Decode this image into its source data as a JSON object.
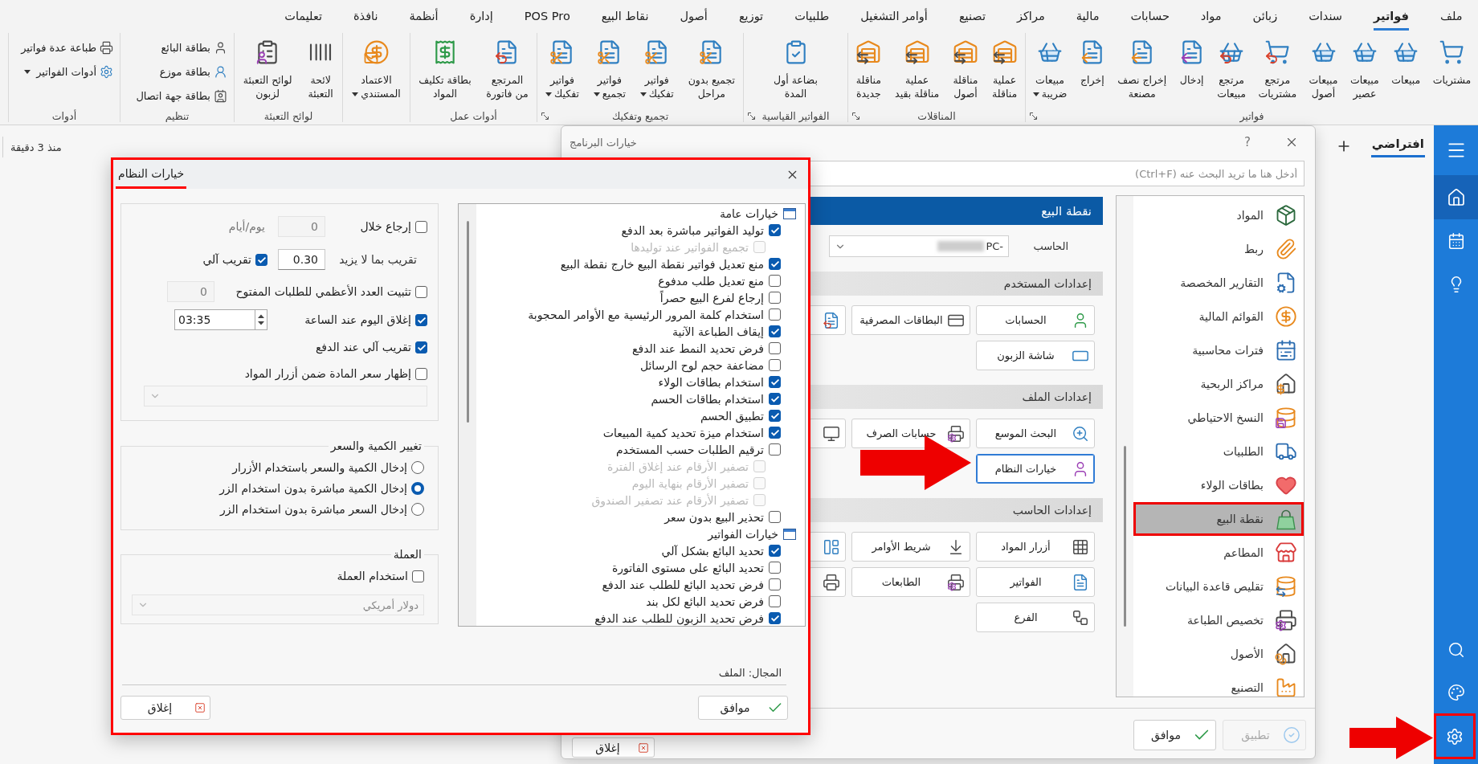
{
  "ribbon": {
    "tabs": [
      {
        "label": "ملف",
        "selected": false
      },
      {
        "label": "فواتير",
        "selected": true
      },
      {
        "label": "سندات",
        "selected": false
      },
      {
        "label": "زبائن",
        "selected": false
      },
      {
        "label": "مواد",
        "selected": false
      },
      {
        "label": "حسابات",
        "selected": false
      },
      {
        "label": "مالية",
        "selected": false
      },
      {
        "label": "مراكز",
        "selected": false
      },
      {
        "label": "تصنيع",
        "selected": false
      },
      {
        "label": "أوامر التشغيل",
        "selected": false
      },
      {
        "label": "طلبيات",
        "selected": false
      },
      {
        "label": "توزيع",
        "selected": false
      },
      {
        "label": "أصول",
        "selected": false
      },
      {
        "label": "نقاط البيع",
        "selected": false
      },
      {
        "label": "POS Pro",
        "selected": false
      },
      {
        "label": "إدارة",
        "selected": false
      },
      {
        "label": "أنظمة",
        "selected": false
      },
      {
        "label": "نافذة",
        "selected": false
      },
      {
        "label": "تعليمات",
        "selected": false
      }
    ],
    "groups": [
      {
        "label": "فواتير",
        "kind": "large",
        "launcher": true,
        "items": [
          {
            "label": "مشتريات",
            "dropdown": false
          },
          {
            "label": "مبيعات",
            "dropdown": false
          },
          {
            "label": "مبيعات\nعصير",
            "dropdown": false
          },
          {
            "label": "مبيعات\nأصول",
            "dropdown": false
          },
          {
            "label": "مرتجع\nمشتريات",
            "dropdown": false
          },
          {
            "label": "مرتجع\nمبيعات",
            "dropdown": false
          },
          {
            "label": "إدخال",
            "dropdown": false
          },
          {
            "label": "إخراج نصف\nمصنعة",
            "dropdown": false
          },
          {
            "label": "إخراج",
            "dropdown": false
          },
          {
            "label": "مبيعات\nضريبة",
            "dropdown": true
          }
        ]
      },
      {
        "label": "المناقلات",
        "kind": "large",
        "launcher": true,
        "items": [
          {
            "label": "عملية\nمناقلة",
            "dropdown": false
          },
          {
            "label": "مناقلة\nأصول",
            "dropdown": false
          },
          {
            "label": "عملية\nمناقلة بقيد",
            "dropdown": false
          },
          {
            "label": "مناقلة\nجديدة",
            "dropdown": false
          }
        ]
      },
      {
        "label": "الفواتير القياسية",
        "kind": "large",
        "launcher": true,
        "items": [
          {
            "label": "بضاعة أول\nالمدة",
            "dropdown": false
          }
        ]
      },
      {
        "label": "تجميع وتفكيك",
        "kind": "large",
        "launcher": true,
        "items": [
          {
            "label": "تجميع بدون\nمراحل",
            "dropdown": false
          },
          {
            "label": "فواتير\nتفكيك",
            "dropdown": true
          },
          {
            "label": "فواتير\nتجميع",
            "dropdown": true
          },
          {
            "label": "فواتير\nتفكيك",
            "dropdown": true
          }
        ]
      },
      {
        "label": "أدوات عمل",
        "kind": "large",
        "launcher": false,
        "items": [
          {
            "label": "المرتجع\nمن فاتورة",
            "dropdown": false
          },
          {
            "label": "بطاقة تكليف\nالمواد",
            "dropdown": false
          }
        ]
      },
      {
        "kind": "large",
        "launcher": false,
        "items": [
          {
            "label": "الاعتماد\nالمستندي",
            "dropdown": true
          }
        ]
      },
      {
        "label": "لوائح التعبئة",
        "kind": "large",
        "launcher": false,
        "items": [
          {
            "label": "لائحة\nالتعبئة",
            "dropdown": false
          },
          {
            "label": "لوائح التعبئة\nلزبون",
            "dropdown": false
          }
        ]
      },
      {
        "label": "تنظيم",
        "kind": "small",
        "launcher": false,
        "items": [
          {
            "label": "بطاقة البائع",
            "dropdown": false
          },
          {
            "label": "بطاقة موزع",
            "dropdown": false
          },
          {
            "label": "بطاقة جهة اتصال",
            "dropdown": false
          }
        ]
      },
      {
        "label": "أدوات",
        "kind": "small",
        "launcher": false,
        "items": [
          {
            "label": "طباعة عدة فواتير",
            "dropdown": false
          },
          {
            "label": "أدوات الفواتير",
            "dropdown": true
          }
        ]
      }
    ]
  },
  "workspace": {
    "updated": "منذ 3 دقيقة",
    "tabs": [
      {
        "label": "افتراضي",
        "selected": true
      }
    ]
  },
  "sidebar": {
    "top": [
      {
        "selected": false
      },
      {
        "selected": true
      },
      {
        "selected": false
      },
      {
        "selected": false
      }
    ],
    "bottom": [
      {
        "selected": false
      },
      {
        "selected": false
      },
      {
        "selected": false
      }
    ]
  },
  "program_options": {
    "title": "خيارات البرنامج",
    "help": "?",
    "search": {
      "placeholder": "أدخل هنا ما تريد البحث عنه (Ctrl+F)"
    },
    "nav": [
      {
        "label": "المواد",
        "selected": false
      },
      {
        "label": "ربط",
        "selected": false
      },
      {
        "label": "التقارير المخصصة",
        "selected": false
      },
      {
        "label": "القوائم المالية",
        "selected": false
      },
      {
        "label": "فترات محاسبية",
        "selected": false
      },
      {
        "label": "مراكز الربحية",
        "selected": false
      },
      {
        "label": "النسخ الاحتياطي",
        "selected": false
      },
      {
        "label": "الطلبيات",
        "selected": false
      },
      {
        "label": "بطاقات الولاء",
        "selected": false
      },
      {
        "label": "نقطة البيع",
        "selected": true
      },
      {
        "label": "المطاعم",
        "selected": false
      },
      {
        "label": "تقليص قاعدة البيانات",
        "selected": false
      },
      {
        "label": "تخصيص الطباعة",
        "selected": false
      },
      {
        "label": "الأصول",
        "selected": false
      },
      {
        "label": "التصنيع",
        "selected": false
      }
    ],
    "heading": "نقطة البيع",
    "computer": {
      "label": "الحاسب",
      "value": "-PC"
    },
    "sections": [
      {
        "title": "إعدادات المستخدم",
        "buttons": [
          {
            "kind": "labeled",
            "label": "الحسابات",
            "focused": false
          },
          {
            "kind": "labeled",
            "label": "البطاقات المصرفية",
            "focused": false
          },
          {
            "kind": "clipped",
            "focused": false
          },
          {
            "kind": "labeled",
            "label": "شاشة الزبون",
            "focused": false
          }
        ]
      },
      {
        "title": "إعدادات الملف",
        "buttons": [
          {
            "kind": "labeled",
            "label": "البحث الموسع",
            "focused": false
          },
          {
            "kind": "labeled",
            "label": "حسابات الصرف",
            "focused": false
          },
          {
            "kind": "clipped",
            "focused": false
          },
          {
            "kind": "labeled",
            "label": "خيارات النظام",
            "focused": true
          }
        ]
      },
      {
        "title": "إعدادات الحاسب",
        "buttons": [
          {
            "kind": "labeled",
            "label": "أزرار المواد",
            "focused": false
          },
          {
            "kind": "labeled",
            "label": "شريط الأوامر",
            "focused": false
          },
          {
            "kind": "clipped",
            "focused": false
          },
          {
            "kind": "labeled",
            "label": "الفواتير",
            "focused": false
          },
          {
            "kind": "labeled",
            "label": "الطابعات",
            "focused": false
          },
          {
            "kind": "clipped",
            "focused": false
          },
          {
            "kind": "labeled",
            "label": "الفرع",
            "focused": false
          }
        ]
      }
    ],
    "footer": [
      {
        "kind": "apply",
        "label": "تطبيق",
        "disabled": true
      },
      {
        "kind": "ok",
        "label": "موافق",
        "disabled": false
      },
      {
        "kind": "close",
        "label": "إغلاق",
        "disabled": false
      }
    ]
  },
  "system_options": {
    "tab": {
      "label": "خيارات النظام",
      "selected": true
    },
    "return_within": {
      "label": "إرجاع خلال",
      "checked": false,
      "value": "0",
      "disabled": true,
      "unit": "يوم/أيام"
    },
    "rounding": {
      "label": "تقريب بما لا يزيد",
      "value": "0.30",
      "auto": {
        "label": "تقريب آلي",
        "checked": true
      }
    },
    "max_open_orders": {
      "label": "تثبيت العدد الأعظمي للطلبات المفتوح",
      "checked": false,
      "value": "0",
      "disabled": true
    },
    "close_day": {
      "label": "إغلاق اليوم عند الساعة",
      "checked": true,
      "time": "03:35"
    },
    "auto_round_on_payment": {
      "label": "تقريب آلي عند الدفع",
      "checked": true
    },
    "show_price": {
      "label": "إظهار سعر المادة ضمن أزرار المواد",
      "checked": false,
      "select_disabled": true
    },
    "quantity_price": {
      "title": "تغيير الكمية والسعر",
      "options": [
        {
          "label": "إدخال الكمية والسعر باستخدام الأزرار",
          "selected": false
        },
        {
          "label": "إدخال الكمية مباشرة بدون استخدام الزر",
          "selected": true
        },
        {
          "label": "إدخال السعر مباشرة بدون استخدام الزر",
          "selected": false
        }
      ]
    },
    "currency": {
      "title": "العملة",
      "use": {
        "label": "استخدام العملة",
        "checked": false
      },
      "select": {
        "value": "دولار أمريكي",
        "disabled": true
      }
    },
    "tree": [
      {
        "label": "خيارات عامة",
        "children": [
          {
            "label": "توليد الفواتير مباشرة بعد الدفع",
            "checked": true,
            "disabled": false,
            "children": [
              {
                "label": "تجميع الفواتير عند توليدها",
                "checked": false,
                "disabled": true
              }
            ]
          },
          {
            "label": "منع تعديل فواتير نقطة البيع خارج نقطة البيع",
            "checked": true,
            "disabled": false
          },
          {
            "label": "منع تعديل طلب مدفوع",
            "checked": false,
            "disabled": false
          },
          {
            "label": "إرجاع لفرع البيع حصراً",
            "checked": false,
            "disabled": false
          },
          {
            "label": "استخدام كلمة المرور الرئيسية مع الأوامر المحجوبة",
            "checked": false,
            "disabled": false
          },
          {
            "label": "إيقاف الطباعة الآنية",
            "checked": true,
            "disabled": false
          },
          {
            "label": "فرض تحديد النمط عند الدفع",
            "checked": false,
            "disabled": false
          },
          {
            "label": "مضاعفة حجم لوح الرسائل",
            "checked": false,
            "disabled": false
          },
          {
            "label": "استخدام بطاقات الولاء",
            "checked": true,
            "disabled": false
          },
          {
            "label": "استخدام بطاقات الحسم",
            "checked": true,
            "disabled": false
          },
          {
            "label": "تطبيق الحسم",
            "checked": true,
            "disabled": false
          },
          {
            "label": "استخدام ميزة تحديد كمية المبيعات",
            "checked": true,
            "disabled": false
          },
          {
            "label": "ترقيم الطلبات حسب المستخدم",
            "checked": false,
            "disabled": false,
            "children": [
              {
                "label": "تصفير الأرقام عند إغلاق الفترة",
                "checked": false,
                "disabled": true
              },
              {
                "label": "تصفير الأرقام بنهاية اليوم",
                "checked": false,
                "disabled": true
              },
              {
                "label": "تصفير الأرقام عند تصفير الصندوق",
                "checked": false,
                "disabled": true
              }
            ]
          },
          {
            "label": "تحذير البيع بدون سعر",
            "checked": false,
            "disabled": false
          }
        ]
      },
      {
        "label": "خيارات الفواتير",
        "children": [
          {
            "label": "تحديد البائع بشكل آلي",
            "checked": true,
            "disabled": false
          },
          {
            "label": "تحديد البائع على مستوى الفاتورة",
            "checked": false,
            "disabled": false
          },
          {
            "label": "فرض تحديد البائع للطلب عند الدفع",
            "checked": false,
            "disabled": false
          },
          {
            "label": "فرض تحديد البائع لكل بند",
            "checked": false,
            "disabled": false
          },
          {
            "label": "فرض تحديد الزبون للطلب عند الدفع",
            "checked": true,
            "disabled": false
          }
        ]
      }
    ],
    "scope": "المجال: الملف",
    "buttons": [
      {
        "kind": "ok",
        "label": "موافق"
      },
      {
        "kind": "close",
        "label": "إغلاق"
      }
    ]
  }
}
